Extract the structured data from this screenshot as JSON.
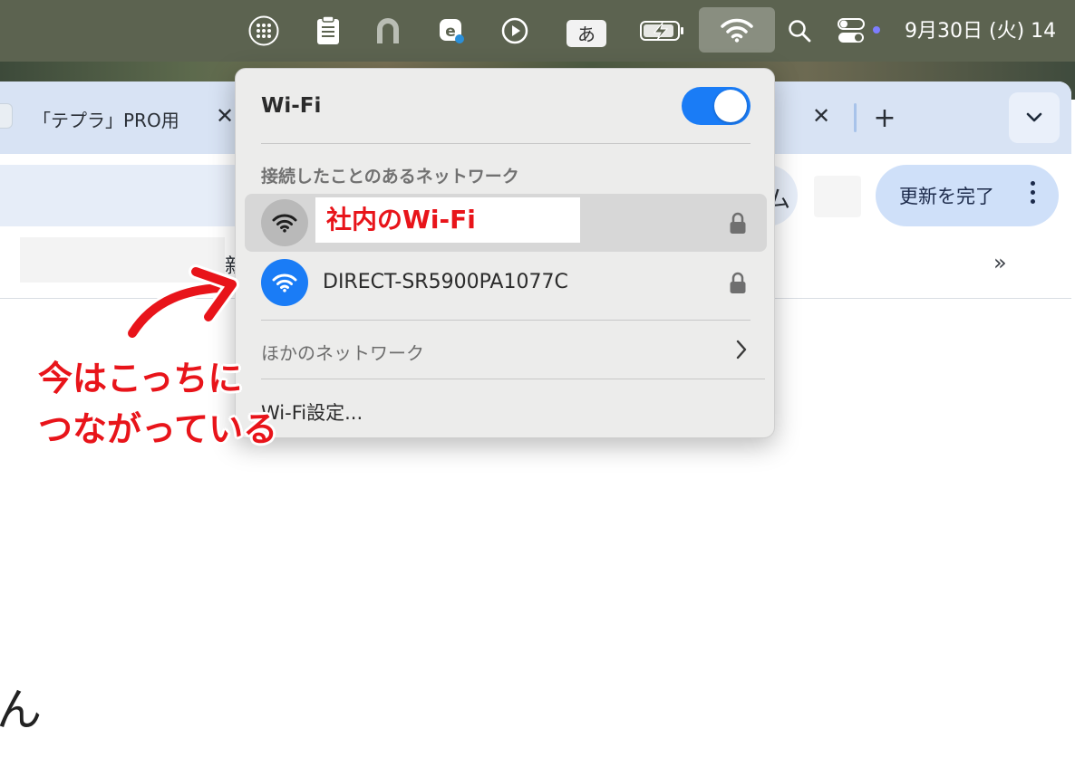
{
  "menubar": {
    "ime_label": "あ",
    "clock": "9月30日 (火)  14",
    "icons": [
      "launchpad-icon",
      "clipboard-icon",
      "arc-icon",
      "e-app-icon",
      "play-icon",
      "ime-icon",
      "battery-charging-icon",
      "wifi-icon",
      "search-icon",
      "control-center-icon"
    ]
  },
  "browser": {
    "tab_title": "「テプラ」PRO用",
    "tab_close": "✕",
    "new_tab": "+",
    "update_button": "更新を完了",
    "bookmarks_overflow": "»",
    "bookmark_fragment": "新",
    "page_fragment": "ん"
  },
  "wifi_menu": {
    "title": "Wi-Fi",
    "enabled": true,
    "known_networks_header": "接続したことのあるネットワーク",
    "networks": [
      {
        "name": "社内のWi-Fi",
        "connected": true,
        "secured": true
      },
      {
        "name": "DIRECT-SR5900PA1077C",
        "connected": false,
        "secured": true
      }
    ],
    "other_networks": "ほかのネットワーク",
    "settings": "Wi-Fi設定..."
  },
  "annotation": {
    "line1": "今はこっちに",
    "line2": "つながっている",
    "color": "#e8141a"
  },
  "colors": {
    "accent": "#1a7cf6",
    "menubar": "#5c6350",
    "annotation_red": "#e8141a"
  }
}
